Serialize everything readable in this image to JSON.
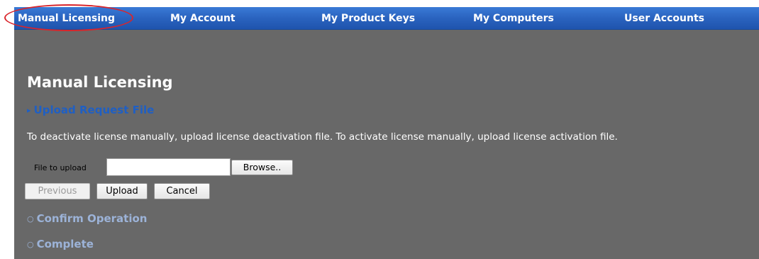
{
  "nav": {
    "items": [
      {
        "label": "Manual Licensing"
      },
      {
        "label": "My Account"
      },
      {
        "label": "My Product Keys"
      },
      {
        "label": "My Computers"
      },
      {
        "label": "User Accounts"
      }
    ],
    "highlighted": "Manual Licensing",
    "highlight_color": "#d9252b",
    "bar_color": "#2a63bf"
  },
  "page": {
    "title": "Manual Licensing",
    "background": "#686868"
  },
  "steps": {
    "upload": {
      "marker": "▸",
      "label": "Upload Request File",
      "state": "active"
    },
    "confirm": {
      "marker": "○",
      "label": "Confirm Operation",
      "state": "pending"
    },
    "complete": {
      "marker": "○",
      "label": "Complete",
      "state": "pending"
    }
  },
  "instructions": "To deactivate license manually, upload license deactivation file. To activate license manually, upload license activation file.",
  "upload_form": {
    "file_label": "File to upload",
    "file_value": "",
    "browse_label": "Browse.."
  },
  "buttons": {
    "previous": "Previous",
    "upload": "Upload",
    "cancel": "Cancel"
  }
}
